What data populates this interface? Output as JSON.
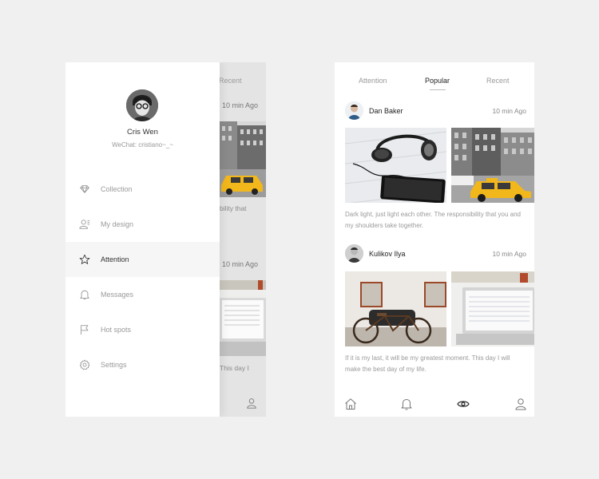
{
  "drawer_screen": {
    "profile": {
      "name": "Cris Wen",
      "wechat": "WeChat: cristiano~_~"
    },
    "menu": [
      {
        "label": "Collection",
        "icon": "diamond-icon",
        "active": false
      },
      {
        "label": "My design",
        "icon": "user-design-icon",
        "active": false
      },
      {
        "label": "Attention",
        "icon": "star-icon",
        "active": true
      },
      {
        "label": "Messages",
        "icon": "bell-icon",
        "active": false
      },
      {
        "label": "Hot spots",
        "icon": "flag-icon",
        "active": false
      },
      {
        "label": "Settings",
        "icon": "gear-icon",
        "active": false
      }
    ],
    "background_feed": {
      "tab_recent": "Recent",
      "time_1": "10 min Ago",
      "snippet_1": "bility that",
      "time_2": "10 min Ago",
      "snippet_2": "This day I"
    }
  },
  "feed_screen": {
    "tabs": [
      {
        "label": "Attention",
        "active": false
      },
      {
        "label": "Popular",
        "active": true
      },
      {
        "label": "Recent",
        "active": false
      }
    ],
    "posts": [
      {
        "author": "Dan Baker",
        "time": "10 min Ago",
        "text": "Dark light, just light each other. The responsibility that you and my shoulders take together."
      },
      {
        "author": "Kulikov Ilya",
        "time": "10 min Ago",
        "text": "If it is my last, it will be my greatest moment. This day I will make the best day of my life."
      }
    ],
    "bottom_nav": [
      "home-icon",
      "bell-icon",
      "eye-icon",
      "user-icon"
    ]
  },
  "colors": {
    "background": "#f0f0f0",
    "taxi": "#f2b71b",
    "active_text": "#222222",
    "muted_text": "#9a9a9a"
  }
}
